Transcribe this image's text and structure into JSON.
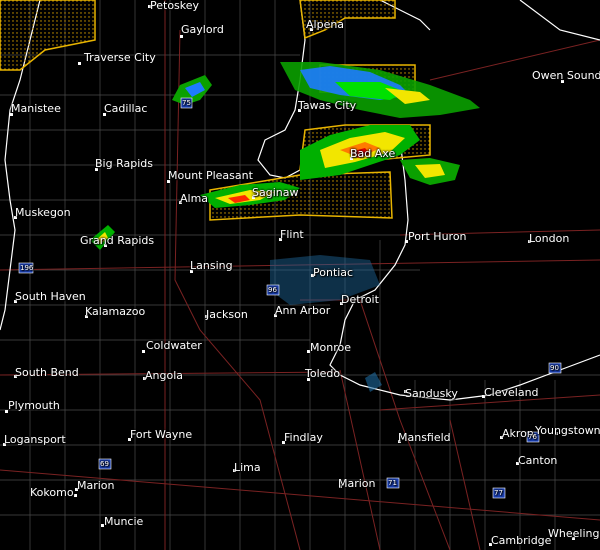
{
  "cities": [
    {
      "name": "Petoskey"
    },
    {
      "name": "Gaylord"
    },
    {
      "name": "Alpena"
    },
    {
      "name": "Traverse City"
    },
    {
      "name": "Owen Sound"
    },
    {
      "name": "Manistee"
    },
    {
      "name": "Cadillac"
    },
    {
      "name": "Tawas City"
    },
    {
      "name": "Bad Axe"
    },
    {
      "name": "Big Rapids"
    },
    {
      "name": "Mount Pleasant"
    },
    {
      "name": "Alma"
    },
    {
      "name": "Saginaw"
    },
    {
      "name": "Muskegon"
    },
    {
      "name": "Grand Rapids"
    },
    {
      "name": "Flint"
    },
    {
      "name": "Port Huron"
    },
    {
      "name": "London"
    },
    {
      "name": "Lansing"
    },
    {
      "name": "Pontiac"
    },
    {
      "name": "South Haven"
    },
    {
      "name": "Detroit"
    },
    {
      "name": "Kalamazoo"
    },
    {
      "name": "Jackson"
    },
    {
      "name": "Ann Arbor"
    },
    {
      "name": "Coldwater"
    },
    {
      "name": "Monroe"
    },
    {
      "name": "South Bend"
    },
    {
      "name": "Angola"
    },
    {
      "name": "Toledo"
    },
    {
      "name": "Sandusky"
    },
    {
      "name": "Cleveland"
    },
    {
      "name": "Plymouth"
    },
    {
      "name": "Fort Wayne"
    },
    {
      "name": "Findlay"
    },
    {
      "name": "Akron"
    },
    {
      "name": "Youngstown"
    },
    {
      "name": "Logansport"
    },
    {
      "name": "Lima"
    },
    {
      "name": "Mansfield"
    },
    {
      "name": "Canton"
    },
    {
      "name": "Marion"
    },
    {
      "name": "Kokomo"
    },
    {
      "name": "Marion"
    },
    {
      "name": "Muncie"
    },
    {
      "name": "Cambridge"
    },
    {
      "name": "Wheeling"
    }
  ],
  "highway_shields": [
    "75",
    "96",
    "196",
    "69",
    "71",
    "77",
    "90",
    "76"
  ],
  "colors": {
    "background": "#000000",
    "warning_outline": "#e8b400",
    "county_lines": "#5a5a5a",
    "state_lines": "#8b2a2a",
    "shoreline": "#ffffff"
  }
}
